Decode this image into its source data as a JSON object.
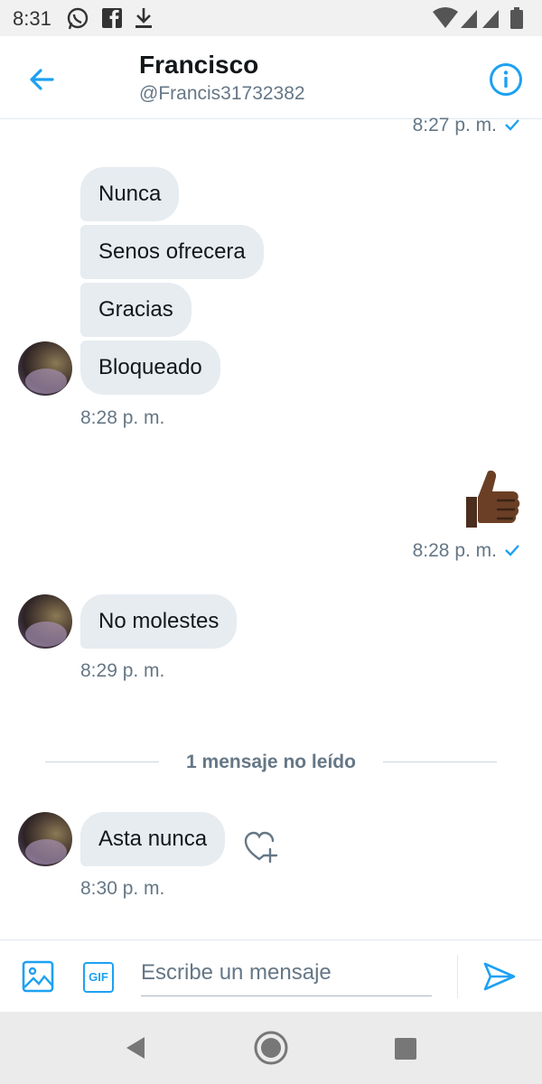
{
  "status_bar": {
    "time": "8:31",
    "icons": [
      "whatsapp-icon",
      "facebook-icon",
      "download-icon",
      "wifi-icon",
      "signal-icon",
      "signal-icon",
      "battery-icon"
    ]
  },
  "header": {
    "name": "Francisco",
    "handle": "@Francis31732382",
    "back_icon": "arrow-left-icon",
    "info_icon": "info-icon"
  },
  "messages": {
    "prev_time": "8:27 p. m.",
    "group1": {
      "bubbles": [
        "Nunca",
        "Senos ofrecera",
        "Gracias",
        "Bloqueado"
      ],
      "time": "8:28 p. m."
    },
    "sent": {
      "emoji": "thumbs-up-icon",
      "time": "8:28 p. m."
    },
    "group2": {
      "text": "No molestes",
      "time": "8:29 p. m."
    },
    "unread_label": "1 mensaje no leído",
    "group3": {
      "text": "Asta nunca",
      "time": "8:30 p. m."
    }
  },
  "composer": {
    "placeholder": "Escribe un mensaje",
    "gif_label": "GIF"
  },
  "colors": {
    "accent": "#1da1f2",
    "bubble_received": "#e6ecf0",
    "secondary_text": "#657786"
  }
}
